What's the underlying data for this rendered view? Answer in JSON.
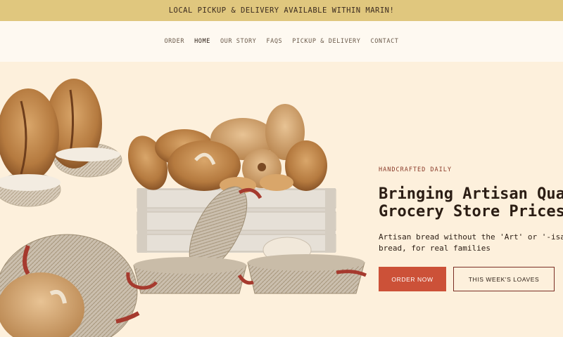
{
  "announcement": "LOCAL PICKUP & DELIVERY AVAILABLE WITHIN MARIN!",
  "nav": {
    "items": [
      {
        "label": "ORDER"
      },
      {
        "label": "HOME"
      },
      {
        "label": "OUR STORY"
      },
      {
        "label": "FAQS"
      },
      {
        "label": "PICKUP & DELIVERY"
      },
      {
        "label": "CONTACT"
      }
    ],
    "active": "HOME"
  },
  "hero": {
    "eyebrow": "HANDCRAFTED DAILY",
    "headline_line1": "Bringing Artisan Quality",
    "headline_line2": "Grocery Store Prices",
    "subtext_line1": "Artisan bread without the 'Art' or '-isan' —",
    "subtext_line2": "bread, for real families",
    "primary_button": "ORDER NOW",
    "secondary_button": "THIS WEEK'S LOAVES"
  },
  "colors": {
    "announcement_bg": "#e0c77e",
    "nav_bg": "#fef9f1",
    "hero_bg": "#fdf0dc",
    "accent": "#cc5138",
    "outline": "#7a2e24"
  }
}
